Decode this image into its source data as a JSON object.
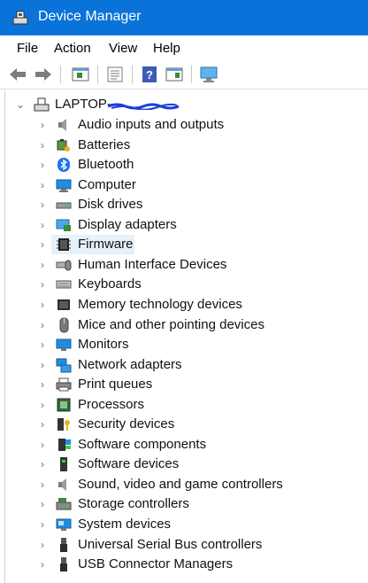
{
  "window": {
    "title": "Device Manager",
    "accent": "#0a73d9"
  },
  "menu": [
    "File",
    "Action",
    "View",
    "Help"
  ],
  "toolbar": {
    "buttons": [
      "back-arrow-icon",
      "forward-arrow-icon",
      "properties-icon",
      "console-tree-icon",
      "help-icon",
      "show-hide-icon",
      "monitor-scan-icon"
    ]
  },
  "tree": {
    "root": "LAPTOP-",
    "root_redacted": true,
    "selected": "Firmware",
    "categories": [
      "Audio inputs and outputs",
      "Batteries",
      "Bluetooth",
      "Computer",
      "Disk drives",
      "Display adapters",
      "Firmware",
      "Human Interface Devices",
      "Keyboards",
      "Memory technology devices",
      "Mice and other pointing devices",
      "Monitors",
      "Network adapters",
      "Print queues",
      "Processors",
      "Security devices",
      "Software components",
      "Software devices",
      "Sound, video and game controllers",
      "Storage controllers",
      "System devices",
      "Universal Serial Bus controllers",
      "USB Connector Managers"
    ]
  }
}
